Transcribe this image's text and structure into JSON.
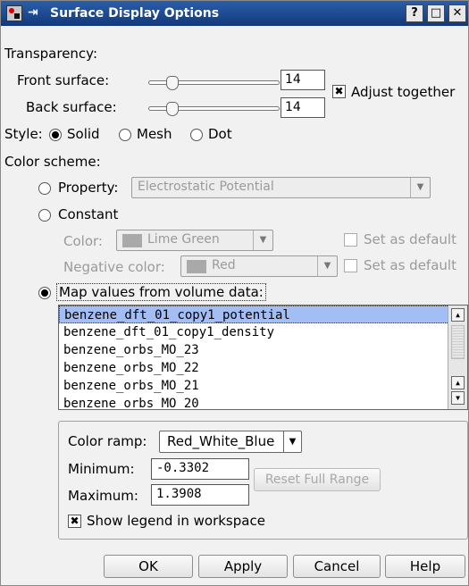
{
  "window": {
    "title": "Surface Display Options",
    "help_btn": "?",
    "maximize_btn": "□",
    "close_btn": "✕",
    "pin_glyph": "⇥"
  },
  "transparency": {
    "label": "Transparency:",
    "front_label": "Front surface:",
    "front_value": "14",
    "back_label": "Back surface:",
    "back_value": "14",
    "adjust_together_label": "Adjust together",
    "adjust_together_checked": true
  },
  "style": {
    "label": "Style:",
    "options": [
      "Solid",
      "Mesh",
      "Dot"
    ],
    "selected": "Solid"
  },
  "color_scheme": {
    "label": "Color scheme:",
    "property_label": "Property:",
    "property_value": "Electrostatic Potential",
    "constant_label": "Constant",
    "color_label": "Color:",
    "color_value": "Lime Green",
    "negative_color_label": "Negative color:",
    "negative_color_value": "Red",
    "set_default_label": "Set as default",
    "set_default_label_2": "Set as default",
    "map_label": "Map values from volume data:",
    "selected_option": "Map values from volume data:"
  },
  "volume_list": {
    "items": [
      "benzene_dft_01_copy1_potential",
      "benzene_dft_01_copy1_density",
      "benzene_orbs_MO_23",
      "benzene_orbs_MO_22",
      "benzene_orbs_MO_21",
      "benzene_orbs_MO_20"
    ],
    "selected_index": 0
  },
  "ramp": {
    "color_ramp_label": "Color ramp:",
    "color_ramp_value": "Red_White_Blue",
    "minimum_label": "Minimum:",
    "minimum_value": "-0.3302",
    "maximum_label": "Maximum:",
    "maximum_value": "1.3908",
    "reset_label": "Reset Full Range",
    "show_legend_label": "Show legend in workspace",
    "show_legend_checked": true
  },
  "buttons": {
    "ok": "OK",
    "apply": "Apply",
    "cancel": "Cancel",
    "help": "Help"
  },
  "colors": {
    "titlebar": "#1f4c95",
    "selection": "#a3bdf5",
    "disabled_text": "#9a9a9a"
  }
}
